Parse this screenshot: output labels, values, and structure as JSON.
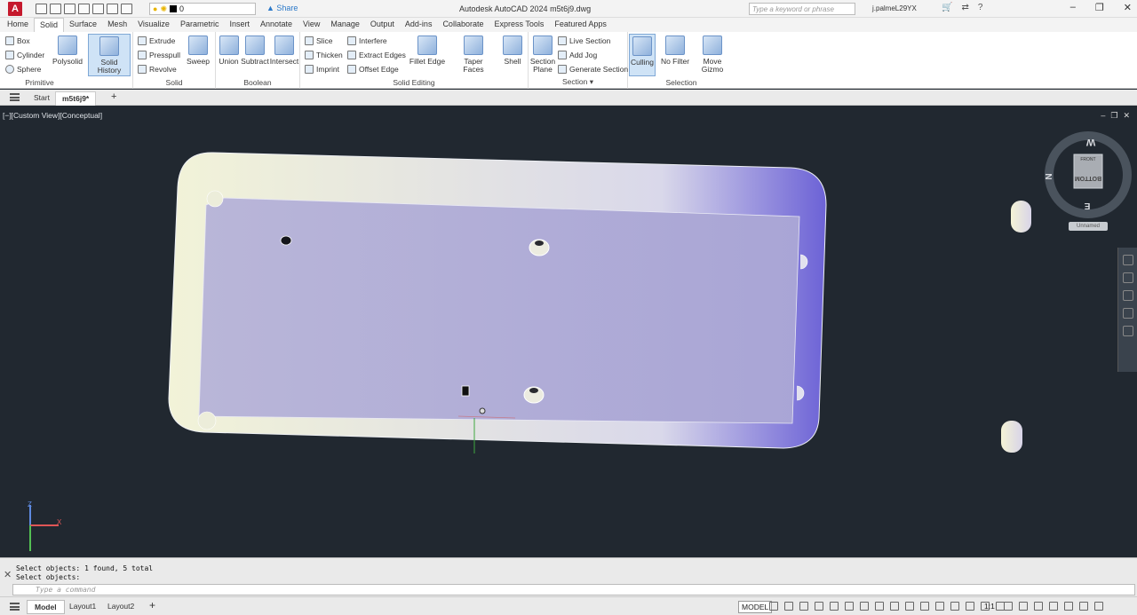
{
  "titlebar": {
    "app_letter": "A",
    "layer_value": "0",
    "share_label": "Share",
    "title": "Autodesk AutoCAD 2024    m5t6j9.dwg",
    "search_placeholder": "Type a keyword or phrase",
    "user": "j.palmeL29YX"
  },
  "ribbon_tabs": [
    "Home",
    "Solid",
    "Surface",
    "Mesh",
    "Visualize",
    "Parametric",
    "Insert",
    "Annotate",
    "View",
    "Manage",
    "Output",
    "Add-ins",
    "Collaborate",
    "Express Tools",
    "Featured Apps"
  ],
  "ribbon_active_tab": "Solid",
  "ribbon": {
    "primitive": {
      "label": "Primitive",
      "box": "Box",
      "cylinder": "Cylinder",
      "sphere": "Sphere",
      "polysolid": "Polysolid"
    },
    "solid_history": "Solid History",
    "solid": {
      "label": "Solid",
      "extrude": "Extrude",
      "presspull": "Presspull",
      "revolve": "Revolve",
      "sweep": "Sweep"
    },
    "boolean": {
      "label": "Boolean",
      "union": "Union",
      "subtract": "Subtract",
      "intersect": "Intersect"
    },
    "solid_editing": {
      "label": "Solid Editing",
      "slice": "Slice",
      "thicken": "Thicken",
      "imprint": "Imprint",
      "interfere": "Interfere",
      "extract_edges": "Extract Edges",
      "offset_edge": "Offset Edge",
      "fillet_edge": "Fillet Edge",
      "taper_faces": "Taper Faces",
      "shell": "Shell"
    },
    "section": {
      "label": "Section",
      "section_plane_1": "Section",
      "section_plane_2": "Plane",
      "live_section": "Live Section",
      "add_jog": "Add Jog",
      "generate_section": "Generate Section"
    },
    "selection": {
      "label": "Selection",
      "culling": "Culling",
      "no_filter": "No Filter",
      "move_gizmo_1": "Move",
      "move_gizmo_2": "Gizmo"
    }
  },
  "doc_tabs": {
    "start": "Start",
    "current": "m5t6j9*"
  },
  "viewport": {
    "label": "[−][Custom View][Conceptual]",
    "viewcube": {
      "face_top": "FRONT",
      "face_front": "BOTTOM",
      "compass_w": "W",
      "compass_n": "N",
      "compass_e": "E",
      "ucs_name": "Unnamed"
    },
    "ucs": {
      "z": "Z",
      "x": "X"
    }
  },
  "command": {
    "history": [
      "Select objects: 1 found, 5 total",
      "Select objects:"
    ],
    "placeholder": "Type a command"
  },
  "status": {
    "tabs": [
      "Model",
      "Layout1",
      "Layout2"
    ],
    "model_badge": "MODEL",
    "scale": "1:1"
  }
}
